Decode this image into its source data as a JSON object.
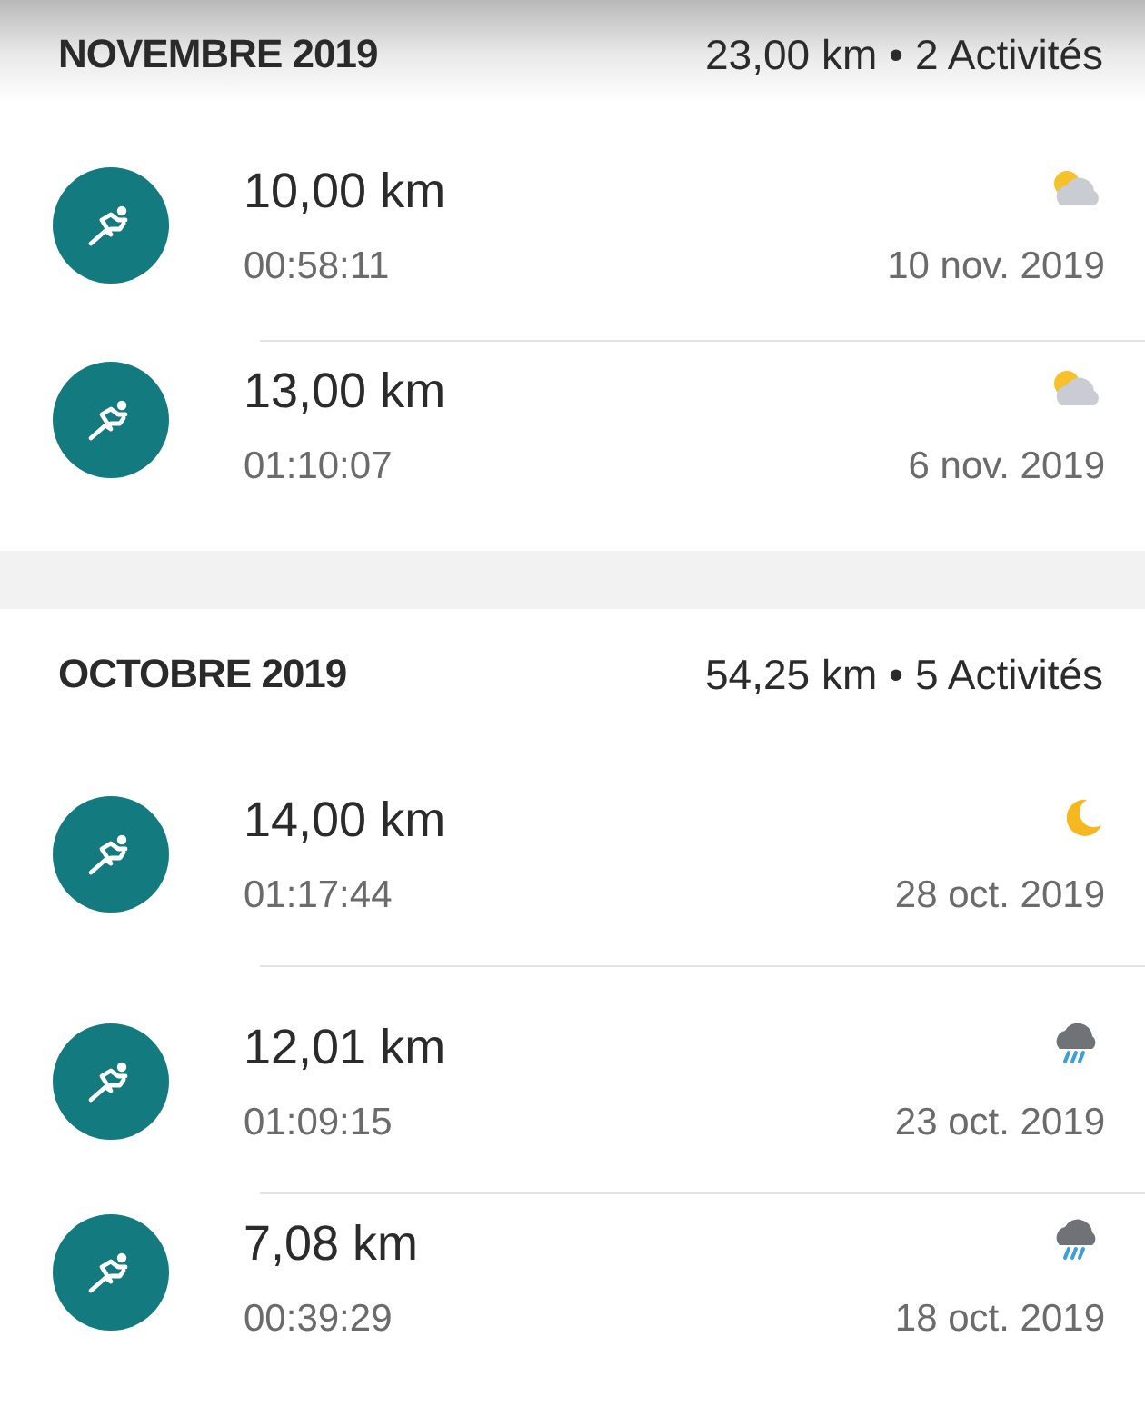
{
  "months": [
    {
      "title": "NOVEMBRE 2019",
      "summary": "23,00 km • 2 Activités",
      "activities": [
        {
          "distance": "10,00 km",
          "duration": "00:58:11",
          "date": "10 nov. 2019",
          "kind": "partly-cloudy"
        },
        {
          "distance": "13,00 km",
          "duration": "01:10:07",
          "date": "6 nov. 2019",
          "kind": "partly-cloudy"
        }
      ]
    },
    {
      "title": "OCTOBRE 2019",
      "summary": "54,25 km • 5 Activités",
      "activities": [
        {
          "distance": "14,00 km",
          "duration": "01:17:44",
          "date": "28 oct. 2019",
          "kind": "night"
        },
        {
          "distance": "12,01 km",
          "duration": "01:09:15",
          "date": "23 oct. 2019",
          "kind": "rain"
        },
        {
          "distance": "7,08 km",
          "duration": "00:39:29",
          "date": "18 oct. 2019",
          "kind": "rain"
        }
      ]
    }
  ]
}
